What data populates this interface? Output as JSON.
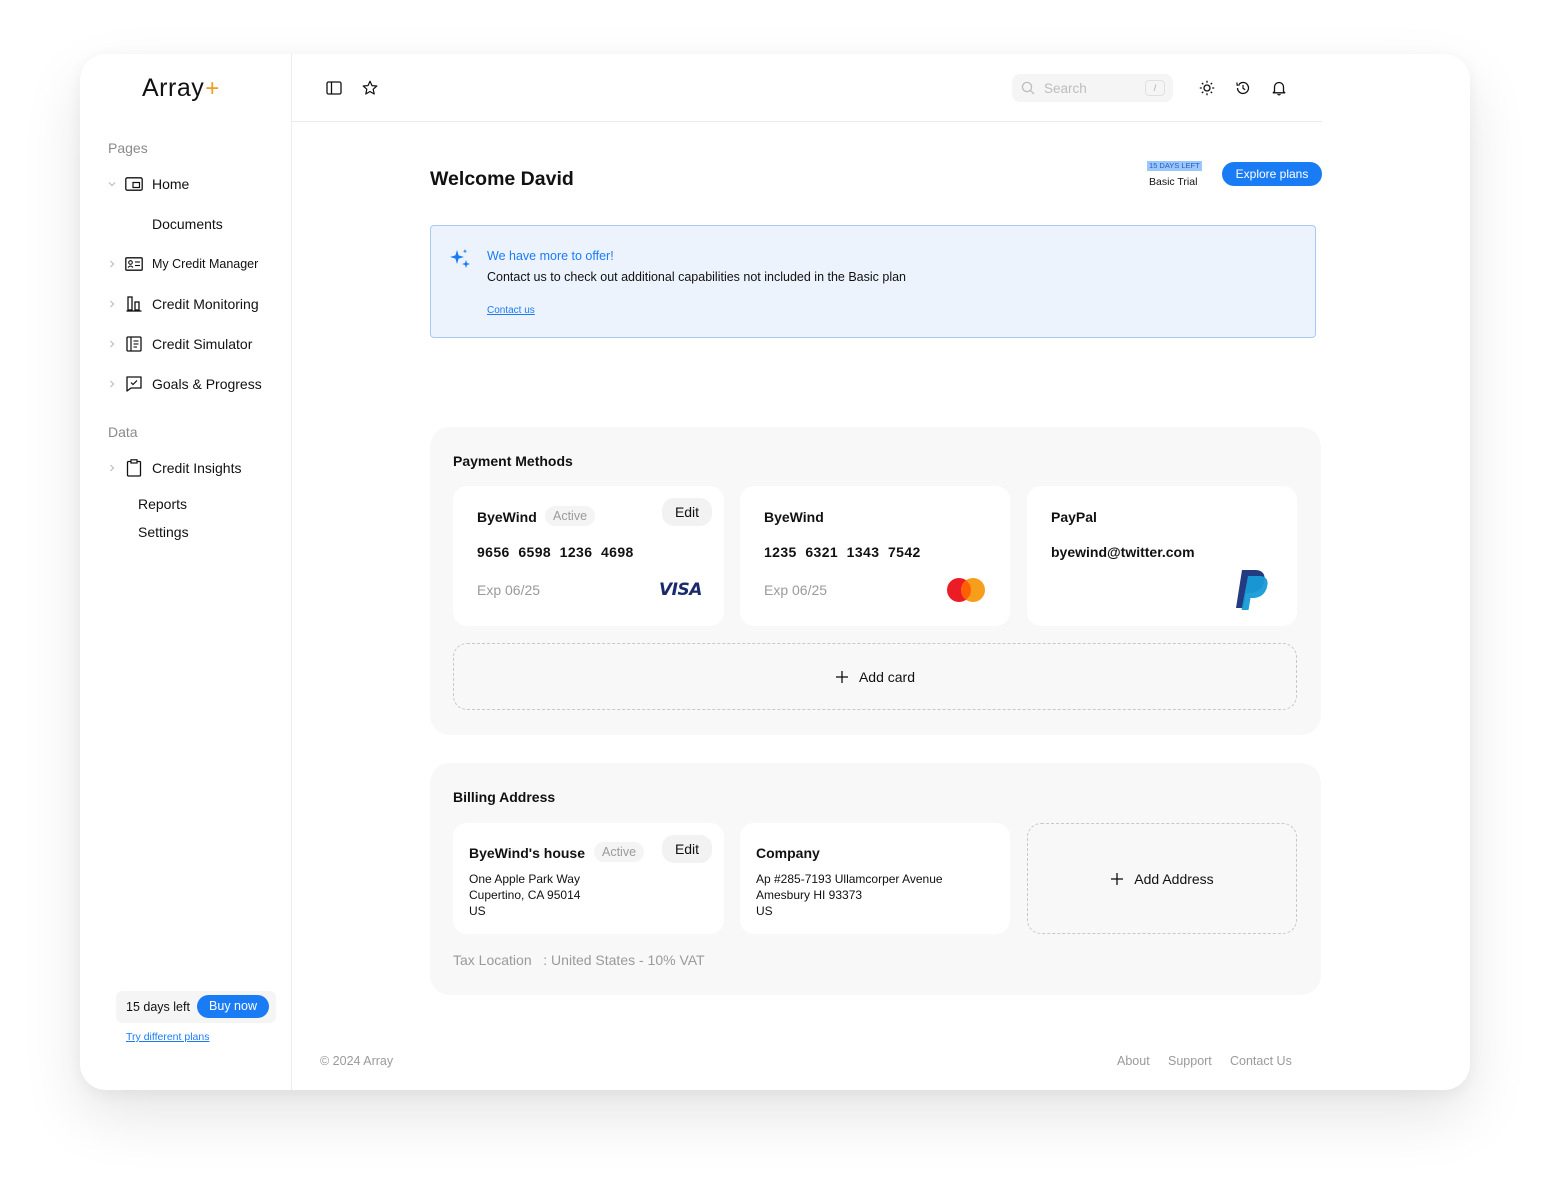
{
  "app": {
    "logo_text": "Array",
    "logo_plus": "+"
  },
  "sidebar": {
    "pages_label": "Pages",
    "data_label": "Data",
    "items": {
      "home": "Home",
      "documents": "Documents",
      "credit_manager": "My Credit Manager",
      "credit_monitoring": "Credit Monitoring",
      "credit_simulator": "Credit Simulator",
      "goals": "Goals & Progress",
      "credit_insights": "Credit Insights",
      "reports": "Reports",
      "settings": "Settings"
    },
    "trial": {
      "days_left": "15 days left",
      "buy_now": "Buy now",
      "try_plans": "Try different plans"
    }
  },
  "topbar": {
    "search_placeholder": "Search",
    "search_shortcut": "/"
  },
  "main": {
    "title": "Welcome David",
    "trial_badge": "15 DAYS LEFT",
    "trial_label": "Basic Trial",
    "explore_button": "Explore plans",
    "banner": {
      "title": "We have more to offer!",
      "text": "Contact us to check out additional capabilities not included in the Basic plan",
      "link": "Contact us"
    },
    "payment": {
      "title": "Payment Methods",
      "cards": [
        {
          "name": "ByeWind",
          "status": "Active",
          "edit": "Edit",
          "number": "9656  6598  1236  4698",
          "exp": "Exp 06/25",
          "brand": "VISA"
        },
        {
          "name": "ByeWind",
          "number": "1235  6321  1343  7542",
          "exp": "Exp 06/25",
          "brand": "mastercard"
        },
        {
          "name": "PayPal",
          "email": "byewind@twitter.com",
          "brand": "paypal"
        }
      ],
      "add_card": "Add card"
    },
    "billing": {
      "title": "Billing Address",
      "addresses": [
        {
          "name": "ByeWind's house",
          "status": "Active",
          "edit": "Edit",
          "line1": "One Apple Park Way",
          "line2": "Cupertino, CA 95014",
          "line3": "US"
        },
        {
          "name": "Company",
          "line1": "Ap #285-7193 Ullamcorper Avenue",
          "line2": "Amesbury HI 93373",
          "line3": "US"
        }
      ],
      "add_address": "Add Address",
      "tax_label": "Tax Location",
      "tax_value": ": United States - 10% VAT"
    }
  },
  "footer": {
    "copyright": "© 2024 Array",
    "links": {
      "about": "About",
      "support": "Support",
      "contact": "Contact Us"
    }
  },
  "colors": {
    "accent": "#1a7cf5",
    "logo_plus": "#f0a020",
    "banner_bg": "#edf3fd"
  }
}
